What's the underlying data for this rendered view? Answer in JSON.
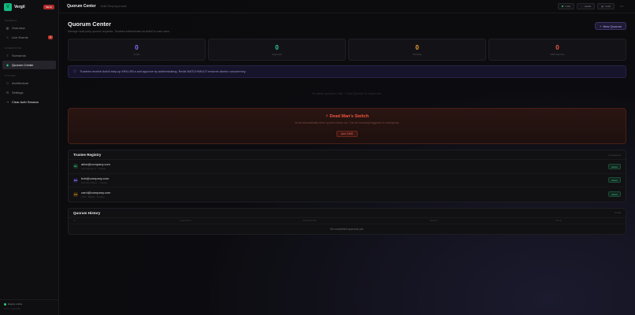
{
  "brand": {
    "name": "Vergil",
    "logo": "V",
    "badge": "BETA"
  },
  "sidebar": {
    "section_main": "GENERAL",
    "section_ops": "OPERATIONS",
    "items": [
      {
        "label": "Overview",
        "icon": "grid-icon"
      },
      {
        "label": "Live Events",
        "icon": "pulse-icon",
        "count": "3"
      },
      {
        "label": "Scenarios",
        "icon": "layers-icon"
      },
      {
        "label": "Quorum Center",
        "icon": "shield-icon"
      },
      {
        "label": "Architecture",
        "icon": "diagram-icon"
      },
      {
        "label": "Settings",
        "icon": "gear-icon"
      },
      {
        "label": "Clear Auth Session",
        "icon": "logout-icon"
      }
    ],
    "section_system": "SYSTEM",
    "footer": {
      "status": "Engine online",
      "sub": "v0.4.2 · build 1128"
    }
  },
  "topbar": {
    "title": "Quorum Center",
    "subtitle": "Multi-Party Approvals",
    "pills": [
      "LIVE",
      "Health",
      "Audit"
    ],
    "faint": "⌘K"
  },
  "page": {
    "title": "Quorum Center",
    "description": "Manage multi-party quorum requests. Trustees authenticate via Auth0 to cast votes.",
    "new_button": "New Quorum"
  },
  "stats": [
    {
      "value": "0",
      "label": "Active",
      "color": "#8b6cff"
    },
    {
      "value": "0",
      "label": "Approved",
      "color": "#2ecc9a"
    },
    {
      "value": "0",
      "label": "Pending",
      "color": "#f0a030"
    },
    {
      "value": "0",
      "label": "DMS Expiries",
      "color": "#f05a40"
    }
  ],
  "info_banner": "Trustees receive Auth0 step-up MFA URLs and approve by authenticating. Redis WATCH/MULTI ensures atomic concurrency.",
  "empty_state": "No active quorums. Click \"+ New Quorum\" to create one.",
  "dms": {
    "title": "Dead Man's Switch",
    "description": "Arms automatically when quorum times out. Can be manually triggered in emergency.",
    "button": "Arm DMS"
  },
  "trustee_registry": {
    "title": "Trustee Registry",
    "meta": "3 registered",
    "trustees": [
      {
        "initials": "AL",
        "email": "alice@company.com",
        "sub": "Last signed in · Trustee",
        "status": "Active",
        "bg": "#173024",
        "fg": "#3ed08f"
      },
      {
        "initials": "BO",
        "email": "bob@company.com",
        "sub": "Security Officer · Trustee",
        "status": "Active",
        "bg": "#221a3a",
        "fg": "#9a86ff"
      },
      {
        "initials": "CA",
        "email": "carol@company.com",
        "sub": "CTO · Board · Trustee",
        "status": "Active",
        "bg": "#33240f",
        "fg": "#f0a030"
      }
    ]
  },
  "quorum_history": {
    "title": "Quorum History",
    "meta": "0 total",
    "columns": [
      "ID",
      "SCENARIO",
      "REQUESTED",
      "RESULT",
      "DATE"
    ],
    "empty": "No completed quorums yet."
  }
}
